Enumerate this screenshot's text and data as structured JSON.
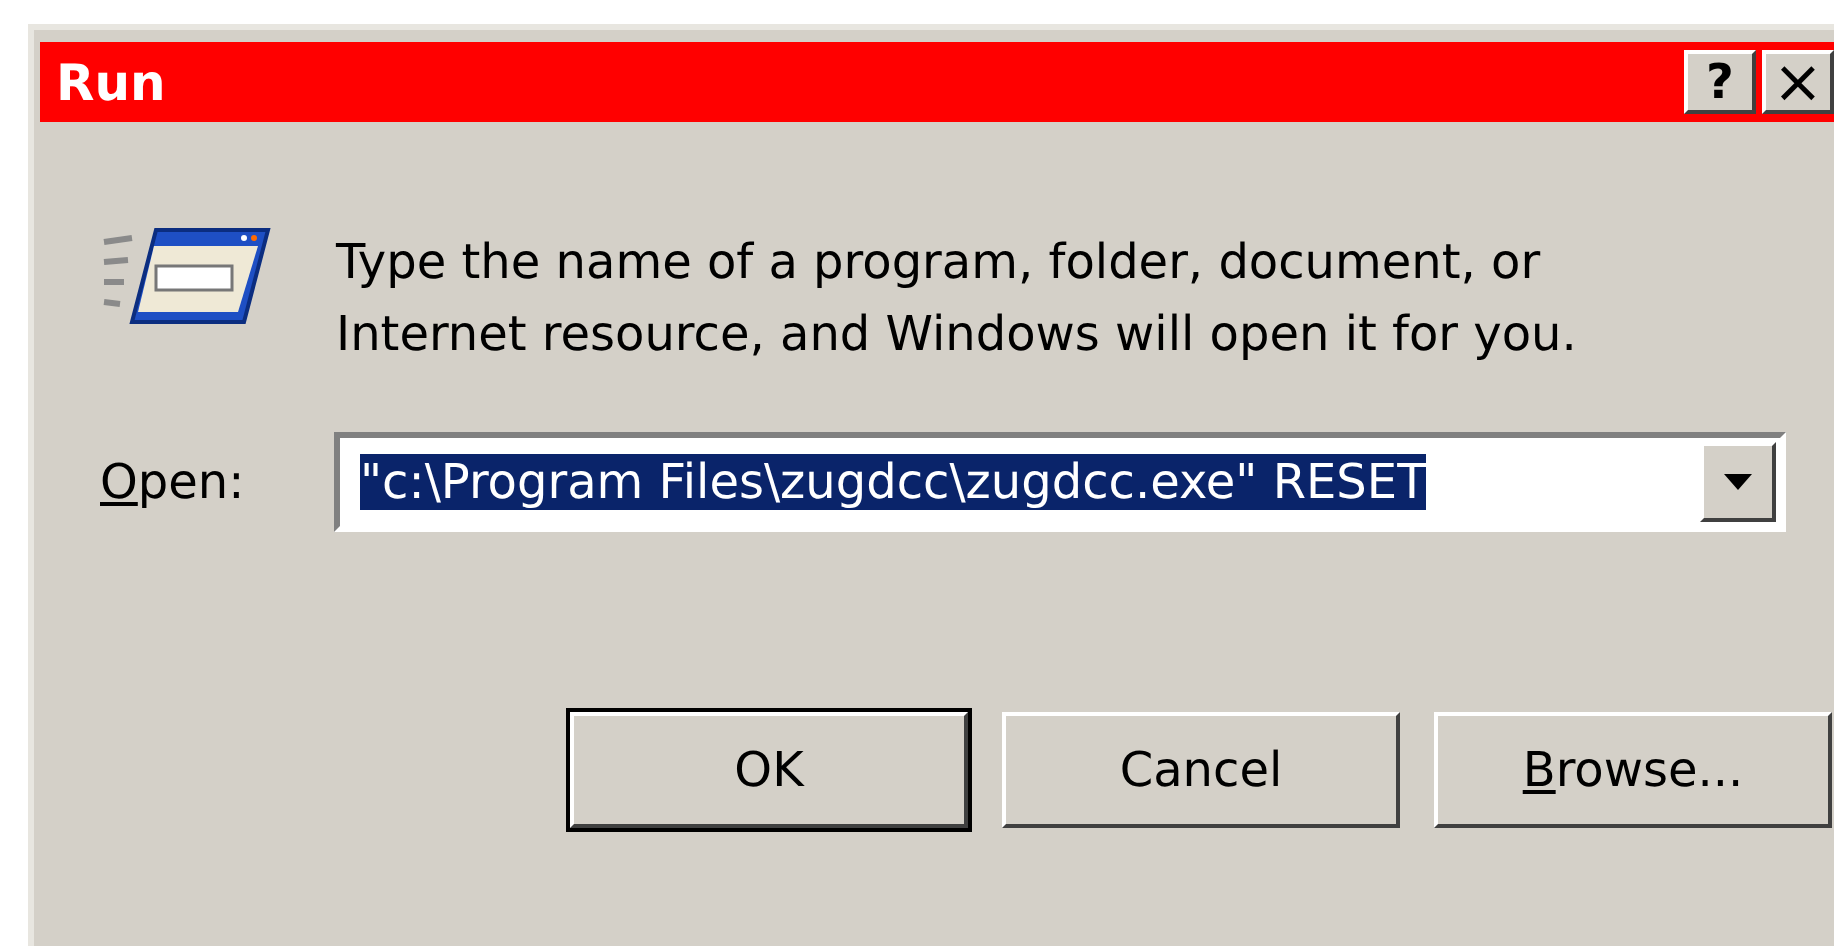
{
  "window": {
    "title": "Run",
    "title_buttons": [
      {
        "kind": "help",
        "label": "?"
      },
      {
        "kind": "close",
        "label": "×"
      }
    ]
  },
  "message": [
    "Type the name of a program, folder, document, or",
    "Internet resource, and Windows will open it for you."
  ],
  "open_field": {
    "label": "Open:",
    "first_letter_underlined": true,
    "value": "\"c:\\Program Files\\zugdcc\\zugdcc.exe\" RESET",
    "value_selected": true
  },
  "buttons": [
    {
      "label": "OK",
      "default": true
    },
    {
      "label": "Cancel",
      "default": false
    },
    {
      "label": "Browse...",
      "default": false,
      "first_letter_underlined": true
    }
  ]
}
